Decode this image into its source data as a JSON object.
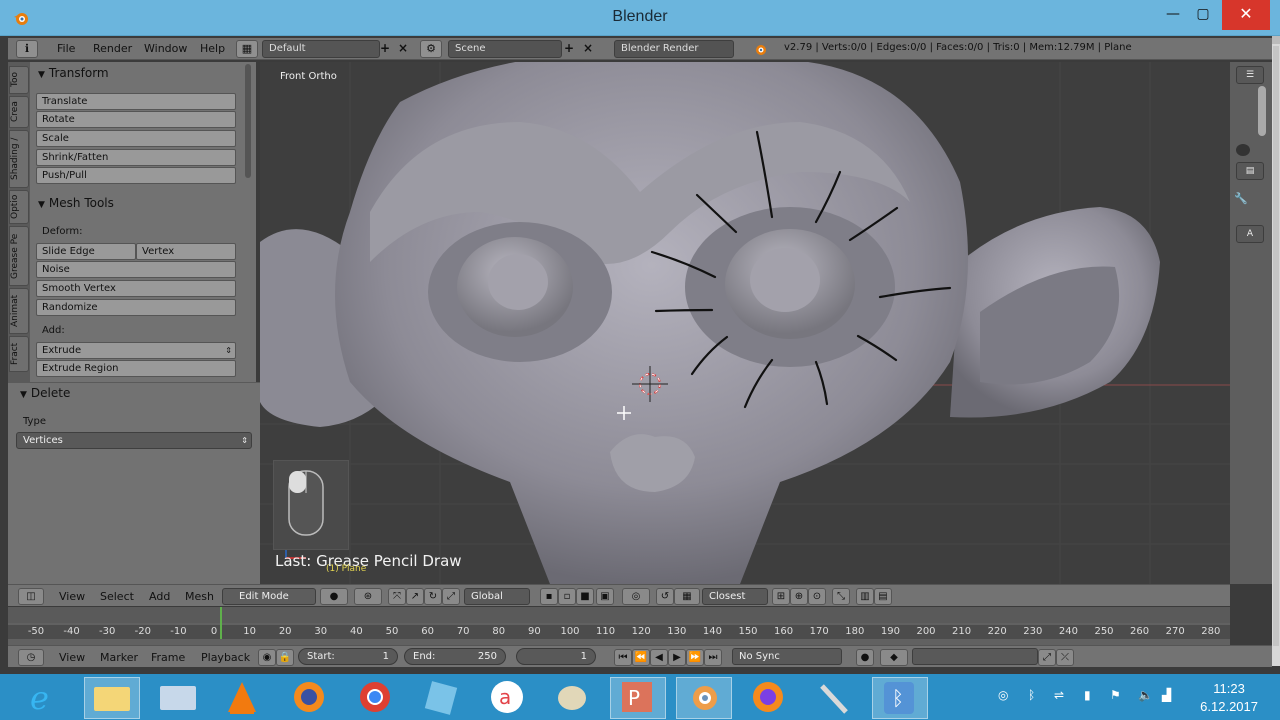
{
  "window": {
    "title": "Blender",
    "minimize": "—",
    "maximize": "▢",
    "close": "✕"
  },
  "header": {
    "menus": [
      "File",
      "Render",
      "Window",
      "Help"
    ],
    "layout": "Default",
    "scene": "Scene",
    "engine": "Blender Render",
    "stats": "v2.79 | Verts:0/0 | Edges:0/0 | Faces:0/0 | Tris:0 | Mem:12.79M | Plane"
  },
  "tabs": [
    "Too",
    "Crea",
    "Shading /",
    "Optio",
    "Grease Pe",
    "Animat",
    "Fract"
  ],
  "shelf": {
    "transform_title": "Transform",
    "transform_buttons": [
      "Translate",
      "Rotate",
      "Scale",
      "Shrink/Fatten",
      "Push/Pull"
    ],
    "mesh_tools_title": "Mesh Tools",
    "deform_label": "Deform:",
    "slide_edge": "Slide Edge",
    "vertex": "Vertex",
    "noise": "Noise",
    "smooth_vertex": "Smooth Vertex",
    "randomize": "Randomize",
    "add_label": "Add:",
    "extrude": "Extrude",
    "extrude_region": "Extrude Region"
  },
  "operator": {
    "title": "Delete",
    "type_label": "Type",
    "type_value": "Vertices"
  },
  "viewport": {
    "view_label": "Front Ortho",
    "last_op": "Last: Grease Pencil Draw",
    "object": "(1) Plane"
  },
  "right_buttons": [
    "A"
  ],
  "view_header": {
    "menus": [
      "View",
      "Select",
      "Add",
      "Mesh"
    ],
    "mode": "Edit Mode",
    "orientation": "Global",
    "snap": "Closest"
  },
  "timeline": {
    "ticks": [
      "-50",
      "-40",
      "-30",
      "-20",
      "-10",
      "0",
      "10",
      "20",
      "30",
      "40",
      "50",
      "60",
      "70",
      "80",
      "90",
      "100",
      "110",
      "120",
      "130",
      "140",
      "150",
      "160",
      "170",
      "180",
      "190",
      "200",
      "210",
      "220",
      "230",
      "240",
      "250",
      "260",
      "270",
      "280"
    ],
    "current_frame": 0
  },
  "timeline_header": {
    "menus": [
      "View",
      "Marker",
      "Frame",
      "Playback"
    ],
    "start_label": "Start:",
    "start_value": "1",
    "end_label": "End:",
    "end_value": "250",
    "frame_value": "1",
    "sync": "No Sync"
  },
  "taskbar": {
    "time": "11:23",
    "date": "6.12.2017"
  },
  "colors": {
    "titlebar": "#6bb5dd",
    "taskbar": "#2b8fc6",
    "close": "#d7362b",
    "grease": "#111111"
  }
}
